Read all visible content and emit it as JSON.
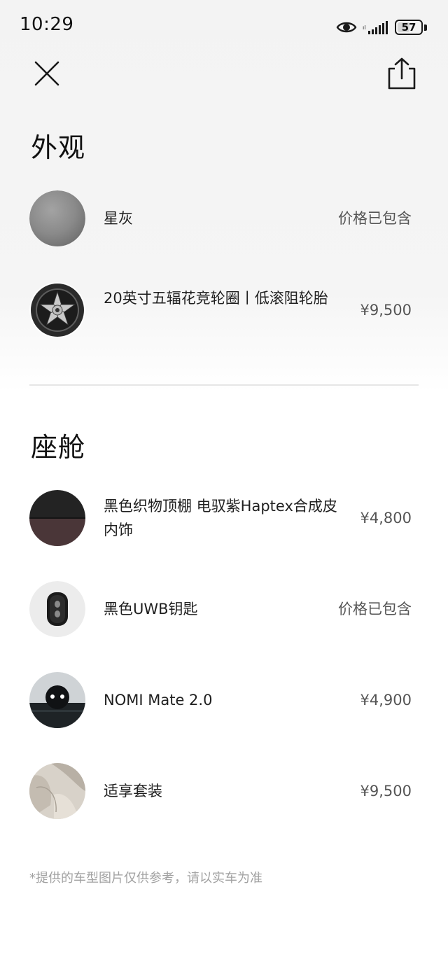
{
  "status_bar": {
    "time": "10:29",
    "battery_level": "57",
    "battery_fraction": 0.57
  },
  "icons": {
    "close": "close-icon",
    "share": "share-icon",
    "eye": "eye-icon",
    "signal": "signal-icon",
    "battery": "battery-icon"
  },
  "exterior": {
    "title": "外观",
    "items": [
      {
        "name": "星灰",
        "price": "价格已包含",
        "thumb": "gray-paint-swatch"
      },
      {
        "name": "20英寸五辐花竞轮圈丨低滚阻轮胎",
        "price": "¥9,500",
        "thumb": "wheel-rim"
      }
    ]
  },
  "cabin": {
    "title": "座舱",
    "items": [
      {
        "name": "黑色织物顶棚 电驭紫Haptex合成皮内饰",
        "price": "¥4,800",
        "thumb": "interior-trim-swatch"
      },
      {
        "name": "黑色UWB钥匙",
        "price": "价格已包含",
        "thumb": "uwb-key"
      },
      {
        "name": "NOMI Mate 2.0",
        "price": "¥4,900",
        "thumb": "nomi-mate"
      },
      {
        "name": "适享套装",
        "price": "¥9,500",
        "thumb": "seat-package"
      }
    ]
  },
  "footer": {
    "disclaimer": "*提供的车型图片仅供参考，请以实车为准"
  },
  "colors": {
    "text_primary": "#1a1a1a",
    "text_price": "#555555",
    "text_muted": "#a2a2a2",
    "divider": "#e6e6e6"
  }
}
